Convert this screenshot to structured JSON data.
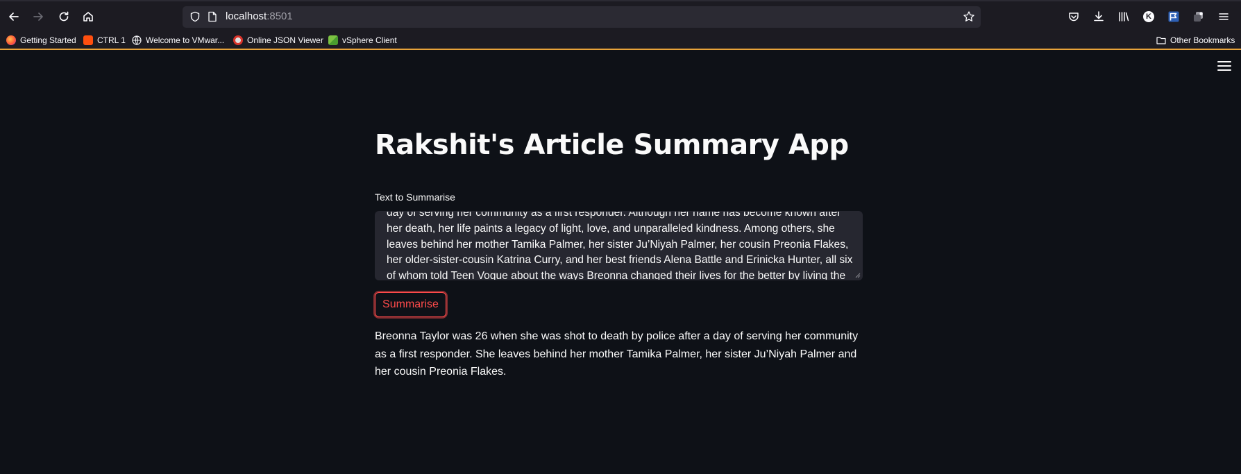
{
  "browser": {
    "url_host": "localhost",
    "url_port": ":8501",
    "bookmarks": [
      {
        "label": "Getting Started"
      },
      {
        "label": "CTRL 1"
      },
      {
        "label": "Welcome to VMwar..."
      },
      {
        "label": "Online JSON Viewer"
      },
      {
        "label": "vSphere Client"
      }
    ],
    "other_bookmarks": "Other Bookmarks",
    "profile_initial": "K"
  },
  "app": {
    "title": "Rakshit's Article Summary App",
    "input_label": "Text to Summarise",
    "input_value": "day of serving her community as a first responder. Although her name has become known after her death, her life paints a legacy of light, love, and unparalleled kindness. Among others, she leaves behind her mother Tamika Palmer, her sister Ju’Niyah Palmer, her cousin Preonia Flakes, her older-sister-cousin Katrina Curry, and her best friends Alena Battle and Erinicka Hunter, all six of whom told Teen Vogue about the ways Breonna changed their lives for the better by living the “Bree way.”",
    "button_label": "Summarise",
    "summary": "Breonna Taylor was 26 when she was shot to death by police after a day of serving her community as a first responder. She leaves behind her mother Tamika Palmer, her sister Ju’Niyah Palmer and her cousin Preonia Flakes."
  },
  "colors": {
    "background": "#0e1117",
    "accent": "#ff4b4b",
    "input_bg": "#262730"
  }
}
